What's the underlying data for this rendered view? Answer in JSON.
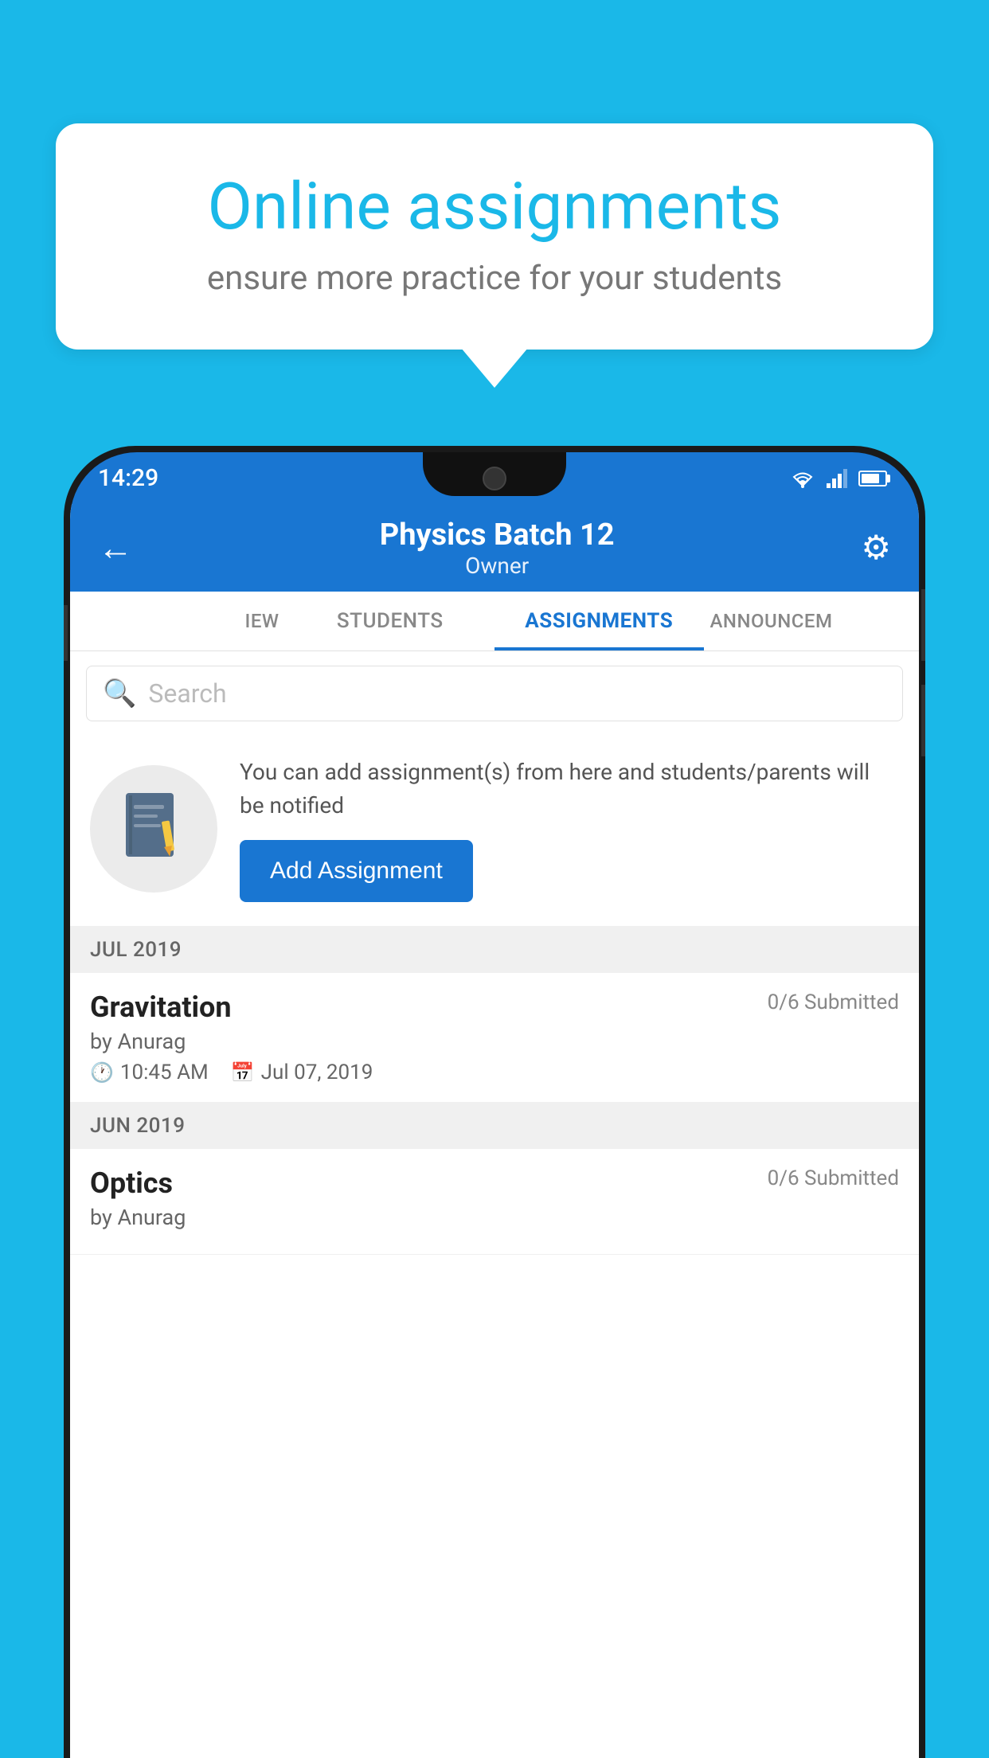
{
  "background_color": "#1ab8e8",
  "speech_bubble": {
    "title": "Online assignments",
    "subtitle": "ensure more practice for your students"
  },
  "status_bar": {
    "time": "14:29"
  },
  "header": {
    "title": "Physics Batch 12",
    "subtitle": "Owner",
    "back_label": "←",
    "settings_label": "⚙"
  },
  "tabs": [
    {
      "id": "iew",
      "label": "IEW",
      "active": false,
      "partial": true
    },
    {
      "id": "students",
      "label": "STUDENTS",
      "active": false
    },
    {
      "id": "assignments",
      "label": "ASSIGNMENTS",
      "active": true
    },
    {
      "id": "announcements",
      "label": "ANNOUNCEM",
      "active": false,
      "partial": true
    }
  ],
  "search": {
    "placeholder": "Search"
  },
  "info_card": {
    "description": "You can add assignment(s) from here and students/parents will be notified",
    "button_label": "Add Assignment"
  },
  "sections": [
    {
      "header": "JUL 2019",
      "assignments": [
        {
          "name": "Gravitation",
          "status": "0/6 Submitted",
          "by": "by Anurag",
          "time": "10:45 AM",
          "date": "Jul 07, 2019"
        }
      ]
    },
    {
      "header": "JUN 2019",
      "assignments": [
        {
          "name": "Optics",
          "status": "0/6 Submitted",
          "by": "by Anurag",
          "time": "",
          "date": ""
        }
      ]
    }
  ]
}
